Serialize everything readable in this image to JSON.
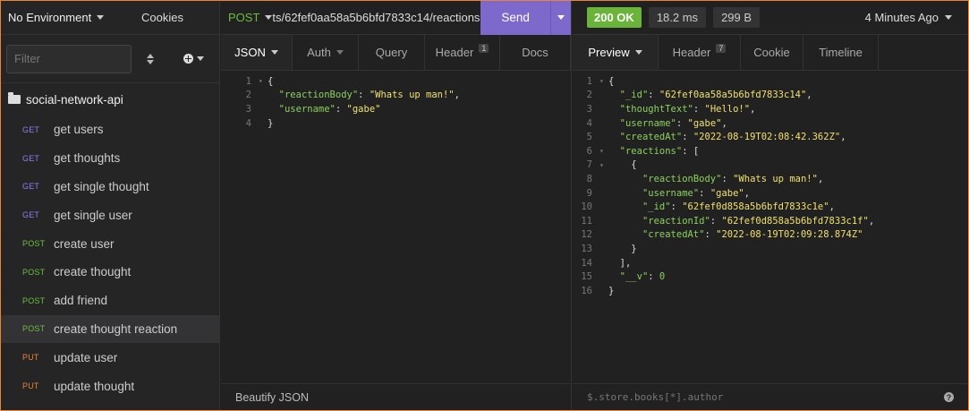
{
  "sidebar": {
    "environment": "No Environment",
    "cookies": "Cookies",
    "filter_placeholder": "Filter",
    "workspace": "social-network-api",
    "requests": [
      {
        "method": "GET",
        "name": "get users"
      },
      {
        "method": "GET",
        "name": "get thoughts"
      },
      {
        "method": "GET",
        "name": "get single thought"
      },
      {
        "method": "GET",
        "name": "get single user"
      },
      {
        "method": "POST",
        "name": "create user"
      },
      {
        "method": "POST",
        "name": "create thought"
      },
      {
        "method": "POST",
        "name": "add friend"
      },
      {
        "method": "POST",
        "name": "create thought reaction"
      },
      {
        "method": "PUT",
        "name": "update user"
      },
      {
        "method": "PUT",
        "name": "update thought"
      }
    ],
    "active_index": 7
  },
  "request": {
    "method": "POST",
    "url": "ts/62fef0aa58a5b6bfd7833c14/reactions",
    "send_label": "Send",
    "tabs": [
      {
        "label": "JSON",
        "badge": ""
      },
      {
        "label": "Auth",
        "badge": ""
      },
      {
        "label": "Query",
        "badge": ""
      },
      {
        "label": "Header",
        "badge": "1"
      },
      {
        "label": "Docs",
        "badge": ""
      }
    ],
    "footer": "Beautify JSON"
  },
  "response": {
    "status": "200 OK",
    "time": "18.2 ms",
    "size": "299 B",
    "time_ago": "4 Minutes Ago",
    "tabs": [
      {
        "label": "Preview",
        "badge": ""
      },
      {
        "label": "Header",
        "badge": "7"
      },
      {
        "label": "Cookie",
        "badge": ""
      },
      {
        "label": "Timeline",
        "badge": ""
      }
    ],
    "filter_placeholder": "$.store.books[*].author"
  },
  "colors": {
    "accent": "#e8833a",
    "send": "#7d69cb",
    "ok": "#6bb43c",
    "get": "#8b7ff0",
    "post": "#6bbf3e",
    "put": "#e8833a"
  }
}
